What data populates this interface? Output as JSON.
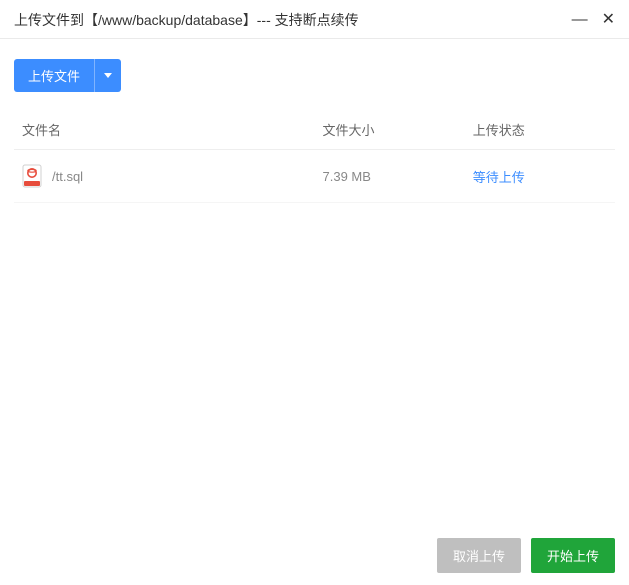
{
  "titlebar": {
    "title": "上传文件到【/www/backup/database】--- 支持断点续传"
  },
  "toolbar": {
    "upload_label": "上传文件"
  },
  "table": {
    "headers": {
      "name": "文件名",
      "size": "文件大小",
      "status": "上传状态"
    },
    "rows": [
      {
        "name": "/tt.sql",
        "size": "7.39 MB",
        "status": "等待上传"
      }
    ]
  },
  "footer": {
    "cancel": "取消上传",
    "start": "开始上传"
  }
}
